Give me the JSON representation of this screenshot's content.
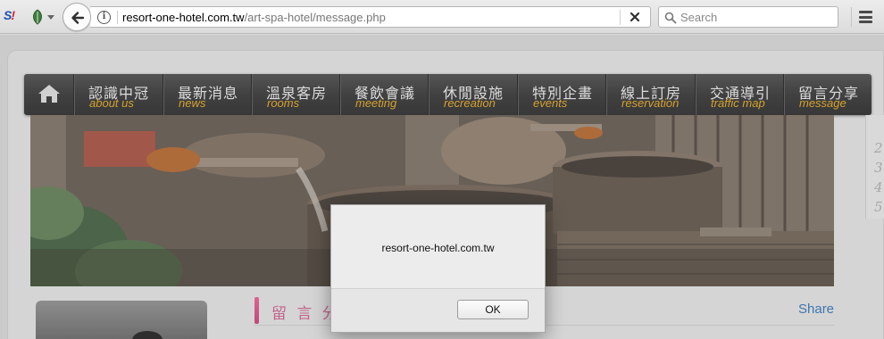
{
  "browser": {
    "url_domain": "resort-one-hotel.com.tw",
    "url_path": "/art-spa-hotel/message.php",
    "search_placeholder": "Search",
    "addon_label_s": "S",
    "addon_label_bang": "!"
  },
  "nav": {
    "items": [
      {
        "zh": "認識中冠",
        "en": "about us"
      },
      {
        "zh": "最新消息",
        "en": "news"
      },
      {
        "zh": "溫泉客房",
        "en": "rooms"
      },
      {
        "zh": "餐飲會議",
        "en": "meeting"
      },
      {
        "zh": "休閒設施",
        "en": "recreation"
      },
      {
        "zh": "特別企畫",
        "en": "events"
      },
      {
        "zh": "線上訂房",
        "en": "reservation"
      },
      {
        "zh": "交通導引",
        "en": "traffic map"
      },
      {
        "zh": "留言分享",
        "en": "message"
      }
    ]
  },
  "side_tabs": [
    "2",
    "3",
    "4",
    "5"
  ],
  "content": {
    "section_title": "留 言 分",
    "share_label": "Share"
  },
  "dialog": {
    "message": "resort-one-hotel.com.tw",
    "ok_label": "OK"
  },
  "colors": {
    "nav_en_text": "#dfa21c",
    "section_title": "#c85a88",
    "share_link": "#2f6fb3"
  }
}
